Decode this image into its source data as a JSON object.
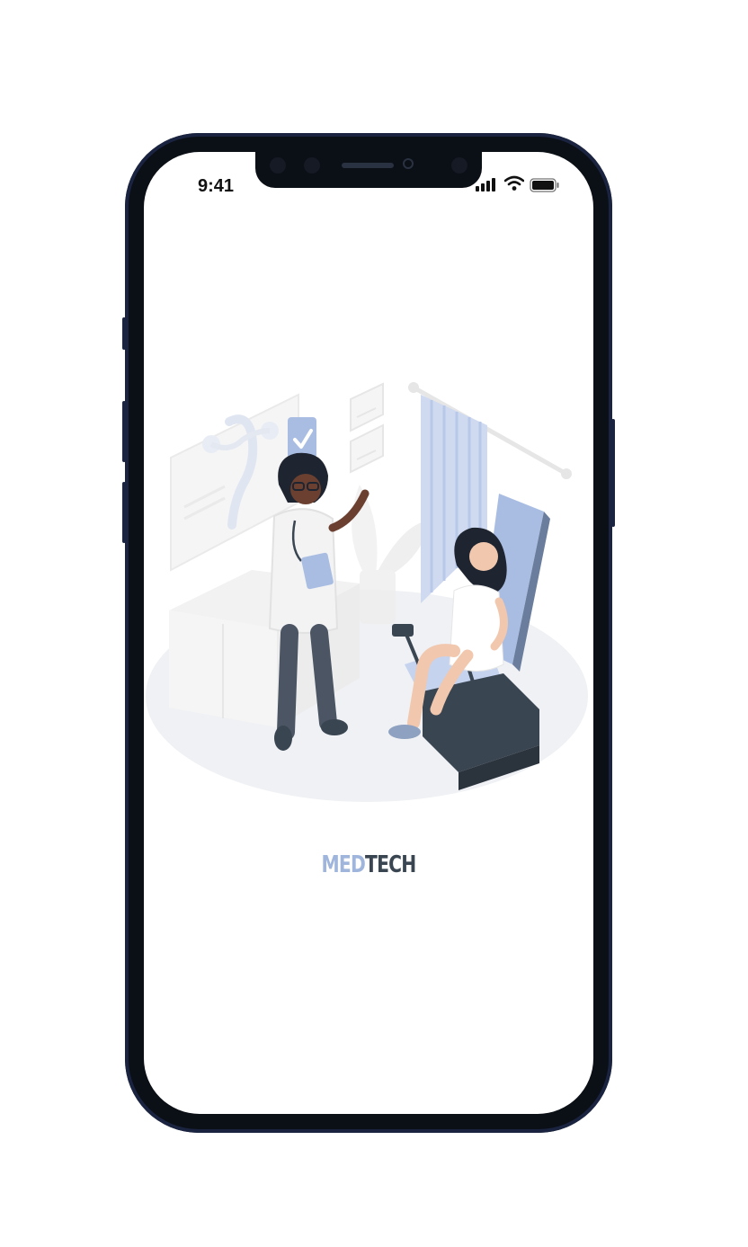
{
  "status_bar": {
    "time": "9:41",
    "icons": [
      "signal-icon",
      "wifi-icon",
      "battery-icon"
    ]
  },
  "illustration": {
    "icon": "doctor-patient-illustration"
  },
  "brand": {
    "part1": "MED",
    "part2": "TECH",
    "colors": {
      "part1": "#9fb5dc",
      "part2": "#3a4552"
    }
  },
  "theme": {
    "frame": "#0b0f16",
    "accent": "#a9bde3",
    "background": "#ffffff"
  }
}
